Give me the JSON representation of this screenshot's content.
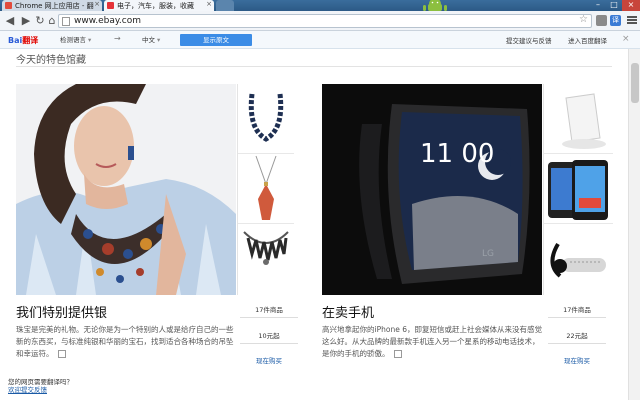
{
  "browser": {
    "tabs": [
      {
        "title": "Chrome 网上应用店 - 翻"
      },
      {
        "title": "电子，汽车，服装，收藏"
      }
    ],
    "url": "www.ebay.com"
  },
  "translate_bar": {
    "logo_main": "Bai",
    "logo_accent": "翻译",
    "source_lang": "检测语言",
    "target_lang": "中文",
    "translate_button": "显示原文",
    "feedback_link": "提交建议与反馈",
    "enter_link": "进入百度翻译"
  },
  "page": {
    "section_title": "今天的特色馆藏",
    "cards": [
      {
        "title": "我们特别提供银",
        "description": "珠宝是完美的礼物。无论你是为一个特别的人或是给疗自己的一些新的东西买，与标准纯银和华丽的宝石，找到适合各种场合的吊坠和幸运符。",
        "items_count": "17件商品",
        "price_from": "10元起",
        "cta": "现在购买"
      },
      {
        "title": "在卖手机",
        "description": "高兴地拿起你的iPhone 6，即复短信或赶上社会媒体从来没有感觉这么好。从大品牌的最新款手机连入另一个星系的移动电话技术，是你的手机的骄傲。",
        "items_count": "17件商品",
        "price_from": "22元起",
        "cta": "现在购买"
      }
    ],
    "phone_screen_time": "11 00",
    "phone_brand": "LG"
  },
  "feedback_widget": {
    "line1": "您的网页需要翻译吗？",
    "line2": "欢迎提交反馈"
  },
  "colors": {
    "accent_blue": "#3b8ce6",
    "link_blue": "#1a5aa6",
    "chrome_frame": "#2c5a86"
  }
}
